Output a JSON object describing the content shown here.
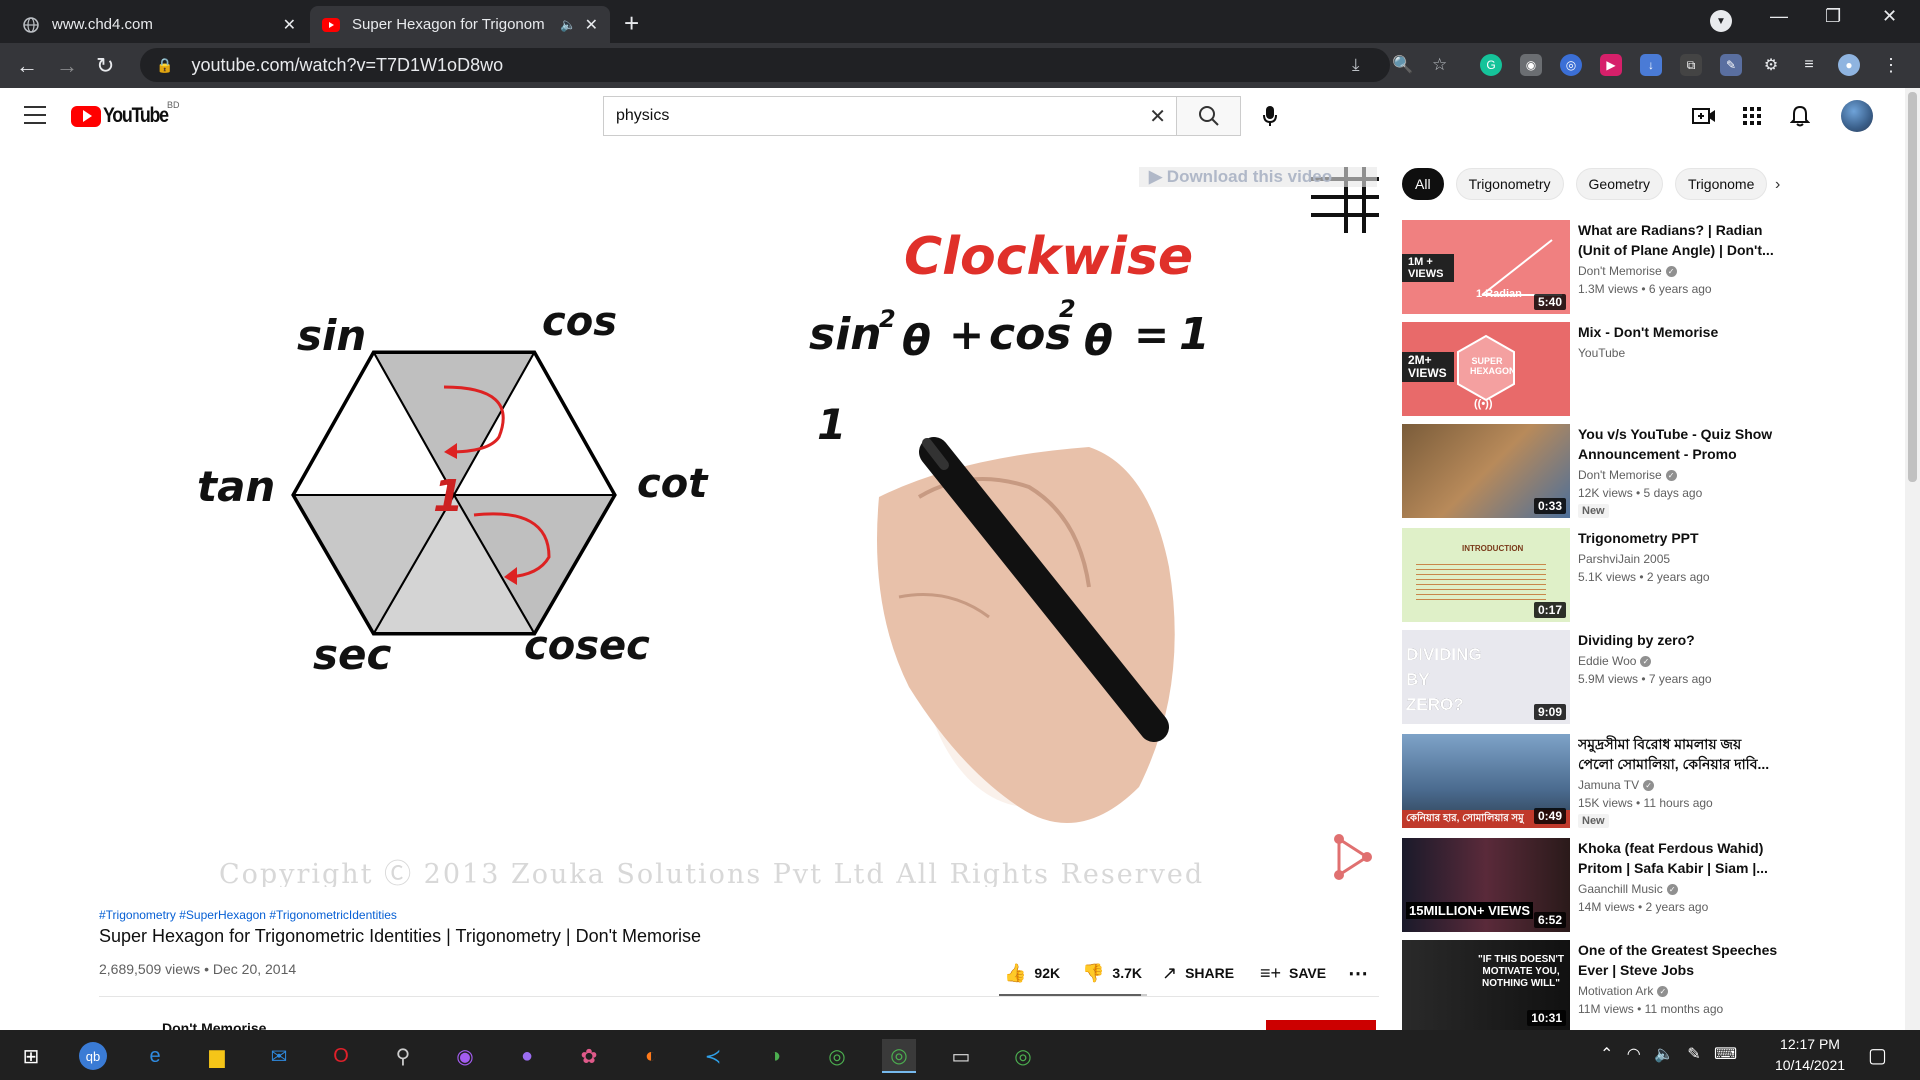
{
  "browser": {
    "tabs": [
      {
        "title": "www.chd4.com",
        "active": false
      },
      {
        "title": "Super Hexagon for Trigonom",
        "active": true
      }
    ],
    "url": "youtube.com/watch?v=T7D1W1oD8wo"
  },
  "youtube": {
    "logo_text": "YouTube",
    "country_code": "BD",
    "search_value": "physics",
    "search_placeholder": "Search"
  },
  "video": {
    "overlay_text": "Download this video",
    "clockwise": "Clockwise",
    "identity_sin": "sin",
    "identity_sup1": "2",
    "identity_theta1": "θ",
    "identity_plus": "+",
    "identity_cos": "cos",
    "identity_sup2": "2",
    "identity_theta2": "θ",
    "identity_equals": "=",
    "identity_one": "1",
    "next_line": "1",
    "hex_labels": {
      "sin": "sin",
      "cos": "cos",
      "tan": "tan",
      "cot": "cot",
      "sec": "sec",
      "cosec": "cosec",
      "center": "1"
    },
    "copyright": "Copyright Ⓒ 2013 Zouka Solutions Pvt Ltd All Rights Reserved",
    "hashtags": "#Trigonometry #SuperHexagon #TrigonometricIdentities",
    "title": "Super Hexagon for Trigonometric Identities | Trigonometry | Don't Memorise",
    "views": "2,689,509 views",
    "date": "Dec 20, 2014",
    "likes": "92K",
    "dislikes": "3.7K",
    "share": "SHARE",
    "save": "SAVE",
    "like_ratio": 0.96,
    "channel_peek": "Don't Memorise"
  },
  "chips": [
    "All",
    "Trigonometry",
    "Geometry",
    "Trigonome"
  ],
  "recommendations": [
    {
      "title": "What are Radians? | Radian (Unit of Plane Angle) | Don't...",
      "channel": "Don't Memorise",
      "verified": true,
      "meta": "1.3M views • 6 years ago",
      "duration": "5:40",
      "badge": "",
      "thumb_badge": "1M + VIEWS",
      "thumb_text": "1 Radian"
    },
    {
      "title": "Mix - Don't Memorise",
      "channel": "YouTube",
      "verified": false,
      "meta": "",
      "duration": "",
      "badge": "",
      "thumb_badge": "2M+ VIEWS",
      "thumb_text": "SUPER HEXAGON"
    },
    {
      "title": "You v/s YouTube - Quiz Show Announcement - Promo",
      "channel": "Don't Memorise",
      "verified": true,
      "meta": "12K views • 5 days ago",
      "duration": "0:33",
      "badge": "New"
    },
    {
      "title": "Trigonometry PPT",
      "channel": "ParshviJain 2005",
      "verified": false,
      "meta": "5.1K views • 2 years ago",
      "duration": "0:17",
      "badge": "",
      "thumb_text": "INTRODUCTION"
    },
    {
      "title": "Dividing by zero?",
      "channel": "Eddie Woo",
      "verified": true,
      "meta": "5.9M views • 7 years ago",
      "duration": "9:09",
      "badge": "",
      "thumb_text": "DIVIDING BY ZERO?"
    },
    {
      "title": "সমুদ্রসীমা বিরোধ মামলায় জয় পেলো সোমালিয়া, কেনিয়ার দাবি...",
      "channel": "Jamuna TV",
      "verified": true,
      "meta": "15K views • 11 hours ago",
      "duration": "0:49",
      "badge": "New",
      "thumb_text": "কেনিয়ার হার, সোমালিয়ার সমু"
    },
    {
      "title": "Khoka (feat Ferdous Wahid) Pritom | Safa Kabir | Siam |...",
      "channel": "Gaanchill Music",
      "verified": true,
      "meta": "14M views • 2 years ago",
      "duration": "6:52",
      "badge": "",
      "thumb_text": "15MILLION+ VIEWS"
    },
    {
      "title": "One of the Greatest Speeches Ever | Steve Jobs",
      "channel": "Motivation Ark",
      "verified": true,
      "meta": "11M views • 11 months ago",
      "duration": "10:31",
      "badge": "",
      "thumb_text": "\"IF THIS DOESN'T MOTIVATE YOU, NOTHING WILL\""
    }
  ],
  "taskbar": {
    "time": "12:17 PM",
    "date": "10/14/2021"
  },
  "colors": {
    "youtube_red": "#ff0000",
    "link_blue": "#065fd4",
    "clockwise_red": "#e0302a",
    "chrome_dark": "#202124"
  }
}
